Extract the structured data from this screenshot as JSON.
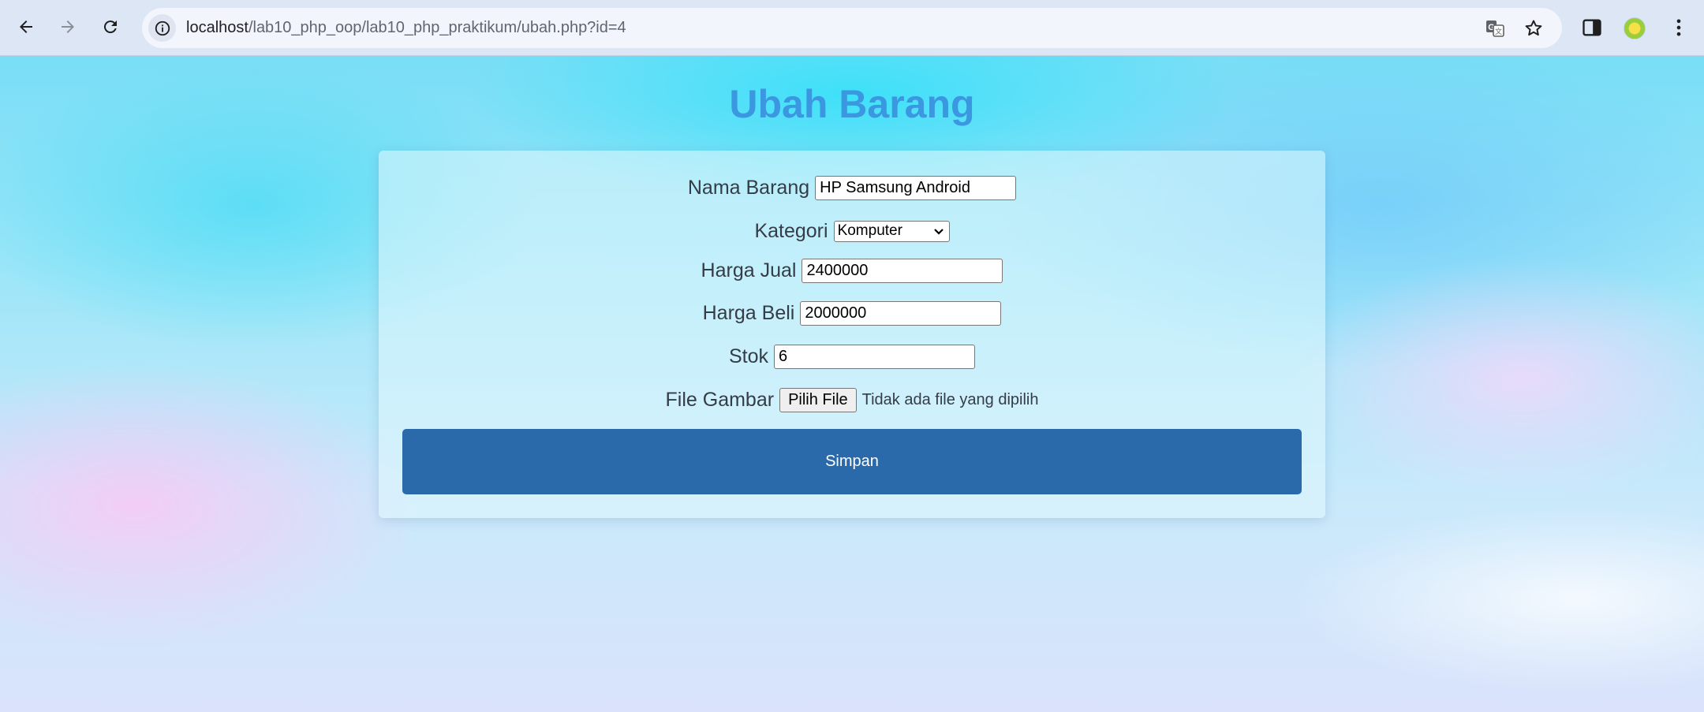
{
  "browser": {
    "url_host": "localhost",
    "url_path": "/lab10_php_oop/lab10_php_praktikum/ubah.php?id=4",
    "icons": [
      "back-icon",
      "forward-icon",
      "reload-icon",
      "info-icon",
      "translate-icon",
      "star-icon",
      "sidepanel-icon",
      "profile-avatar",
      "menu-icon"
    ]
  },
  "page": {
    "title": "Ubah Barang"
  },
  "form": {
    "nama": {
      "label": "Nama Barang",
      "value": "HP Samsung Android"
    },
    "kategori": {
      "label": "Kategori",
      "selected": "Komputer"
    },
    "harga_jual": {
      "label": "Harga Jual",
      "value": "2400000"
    },
    "harga_beli": {
      "label": "Harga Beli",
      "value": "2000000"
    },
    "stok": {
      "label": "Stok",
      "value": "6"
    },
    "gambar": {
      "label": "File Gambar",
      "button": "Pilih File",
      "status": "Tidak ada file yang dipilih"
    },
    "submit_label": "Simpan"
  },
  "colors": {
    "title": "#3a97e0",
    "button": "#2a6aab"
  }
}
